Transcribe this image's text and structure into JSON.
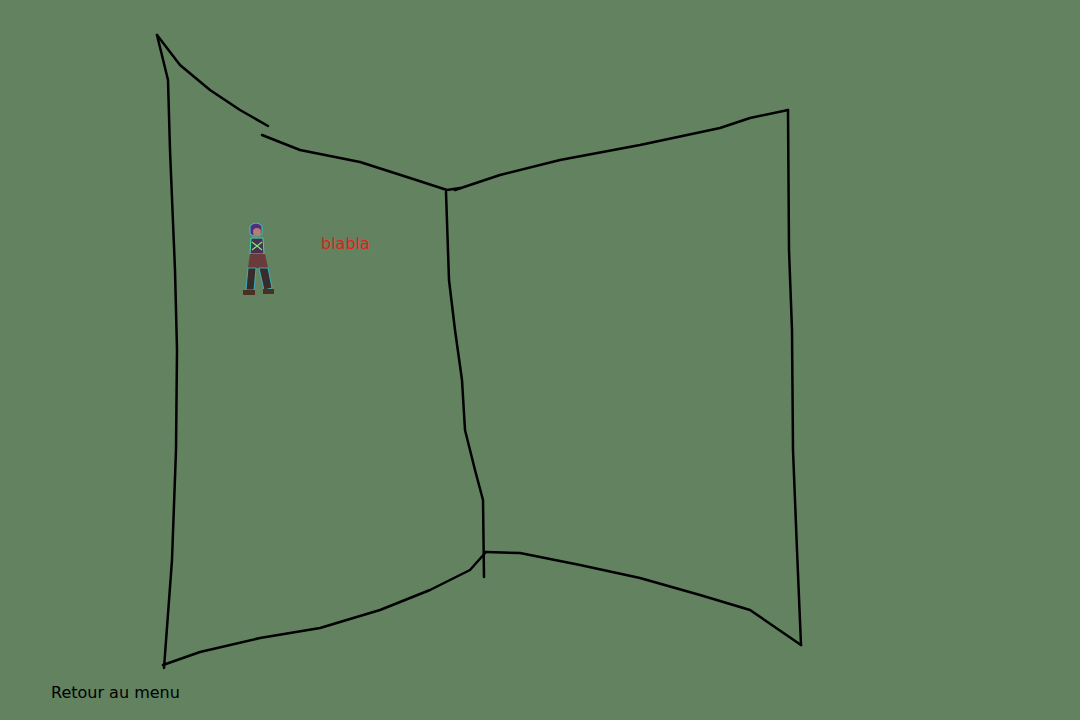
{
  "scene": {
    "speech": {
      "text": "blabla"
    }
  },
  "menu_link": {
    "label": "Retour au menu"
  }
}
